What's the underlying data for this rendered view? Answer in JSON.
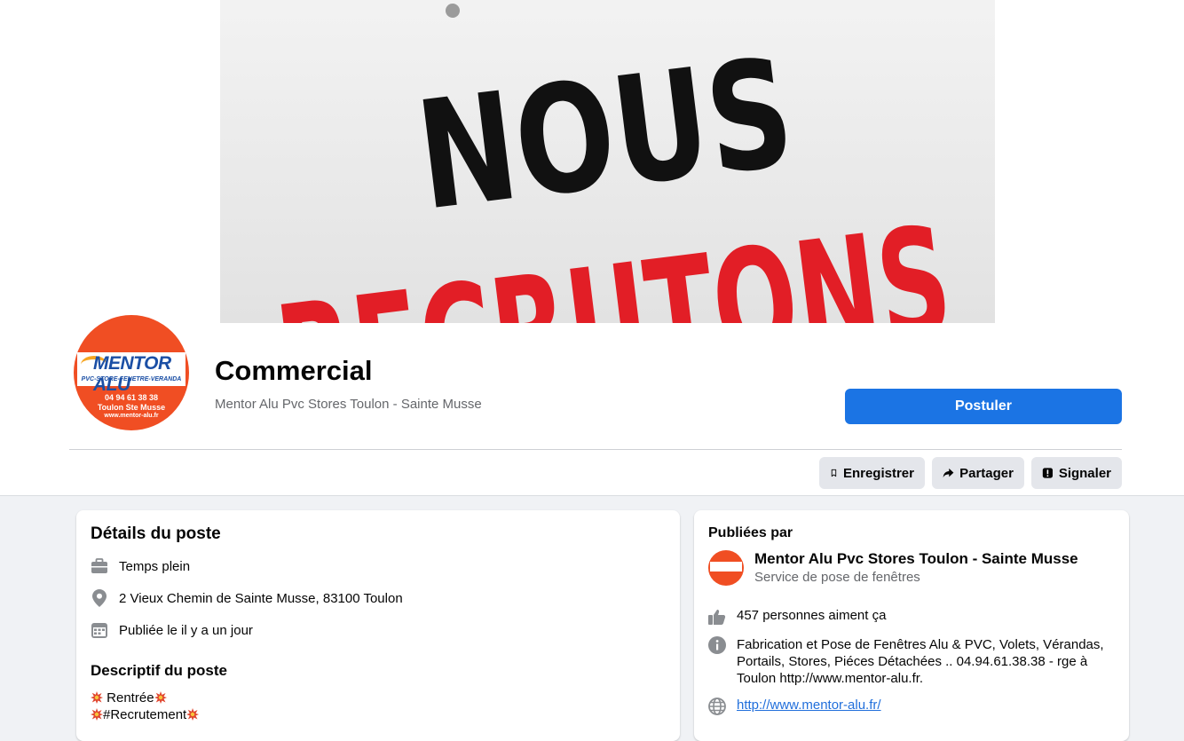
{
  "cover": {
    "line1": "NOUS",
    "line2": "RECRUTONS"
  },
  "logo": {
    "brand": "MENTOR ALU",
    "tagline": "PVC-STORE-FENETRE-VERANDA",
    "phone": "04 94 61 38 38",
    "city": "Toulon  Ste Musse",
    "web": "www.mentor-alu.fr"
  },
  "job": {
    "title": "Commercial",
    "company": "Mentor Alu Pvc Stores Toulon - Sainte Musse",
    "apply_label": "Postuler"
  },
  "actions": {
    "save": "Enregistrer",
    "share": "Partager",
    "report": "Signaler"
  },
  "details": {
    "heading": "Détails du poste",
    "type": "Temps plein",
    "address": "2 Vieux Chemin de Sainte Musse, 83100 Toulon",
    "posted": "Publiée le il y a un jour"
  },
  "description": {
    "heading": "Descriptif du poste",
    "line1": " Rentrée",
    "line2": "#Recrutement"
  },
  "publisher": {
    "heading": "Publiées par",
    "name": "Mentor Alu Pvc Stores Toulon - Sainte Musse",
    "category": "Service de pose de fenêtres",
    "likes": "457 personnes aiment ça",
    "about": "Fabrication et Pose de Fenêtres Alu & PVC, Volets, Vérandas, Portails, Stores, Piéces Détachées .. 04.94.61.38.38 - rge à Toulon http://www.mentor-alu.fr.",
    "website": "http://www.mentor-alu.fr/"
  },
  "colors": {
    "accent": "#1b74e4",
    "logo_orange": "#f04e23",
    "sign_red": "#e21e26"
  }
}
